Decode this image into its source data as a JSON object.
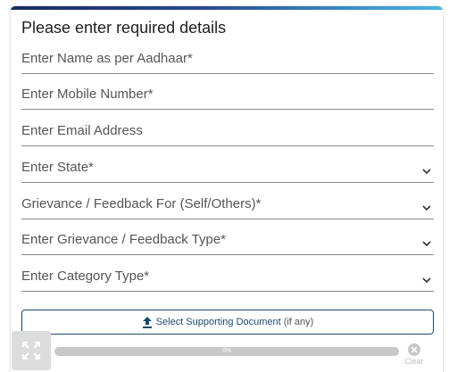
{
  "form": {
    "title": "Please enter required details",
    "fields": [
      {
        "label": "Enter Name as per Aadhaar*",
        "type": "text"
      },
      {
        "label": "Enter Mobile Number*",
        "type": "text"
      },
      {
        "label": "Enter Email Address",
        "type": "text"
      },
      {
        "label": "Enter State*",
        "type": "select",
        "icon": "chevron-down-icon"
      },
      {
        "label": "Grievance / Feedback For (Self/Others)*",
        "type": "select",
        "icon": "chevron-down-icon"
      },
      {
        "label": "Enter Grievance / Feedback Type*",
        "type": "select",
        "icon": "chevron-down-icon"
      },
      {
        "label": "Enter Category Type*",
        "type": "select",
        "icon": "chevron-down-icon"
      }
    ]
  },
  "upload": {
    "button_label": "Select Supporting Document",
    "button_note": "(if any)",
    "icon": "upload-icon",
    "progress_text": "0%",
    "progress_value": 0,
    "clear_label": "Clear"
  },
  "colors": {
    "accent_dark": "#1a2a5e",
    "accent_light": "#4cb6e0",
    "button_border": "#1b4a6e"
  }
}
